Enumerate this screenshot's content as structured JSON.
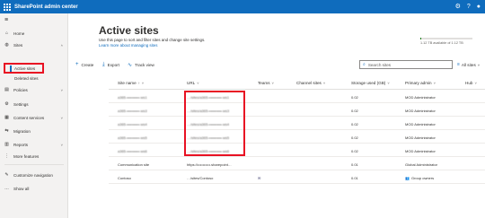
{
  "header": {
    "app_title": "SharePoint admin center",
    "icons": [
      "waffle-icon",
      "gear-icon",
      "help-icon",
      "avatar-icon"
    ]
  },
  "sidebar": {
    "items": [
      {
        "label": "Home",
        "icon": "home-icon"
      },
      {
        "label": "Sites",
        "icon": "globe-icon",
        "expanded": true
      },
      {
        "label": "Active sites",
        "sub": true,
        "active": true
      },
      {
        "label": "Deleted sites",
        "sub": true
      },
      {
        "label": "Policies",
        "icon": "policy-icon",
        "chevron": true
      },
      {
        "label": "Settings",
        "icon": "gear-icon"
      },
      {
        "label": "Content services",
        "icon": "content-icon",
        "chevron": true
      },
      {
        "label": "Migration",
        "icon": "migration-icon"
      },
      {
        "label": "Reports",
        "icon": "reports-icon",
        "chevron": true
      },
      {
        "label": "More features",
        "icon": "more-features-icon"
      },
      {
        "label": "Customize navigation",
        "icon": "pencil-icon"
      },
      {
        "label": "Show all",
        "icon": "ellipsis-icon"
      }
    ]
  },
  "page": {
    "title": "Active sites",
    "description": "Use this page to sort and filter sites and change site settings.",
    "learn_more": "Learn more about managing sites"
  },
  "storage": {
    "text": "1.12 TB available of 1.12 TB",
    "used_fraction": 0.02
  },
  "toolbar": {
    "create": "Create",
    "export": "Export",
    "track_view": "Track view",
    "search_placeholder": "Search sites",
    "filter": "All sites"
  },
  "table": {
    "columns": [
      "Site name",
      "URL",
      "Teams",
      "Channel sites",
      "Storage used (GB)",
      "Primary admin",
      "Hub"
    ],
    "sort_indicator": "↑",
    "rows": [
      {
        "name": "a365-••••••••••-ws1",
        "url": "…/sites/a365-••••••••••-ws1",
        "teams": "",
        "channel": "",
        "storage": "0.02",
        "admin": "MOD Administrator",
        "hub": "",
        "blurred": true
      },
      {
        "name": "a365-••••••••••-ws3",
        "url": "…/sites/a365-••••••••••-ws3",
        "teams": "",
        "channel": "",
        "storage": "0.02",
        "admin": "MOD Administrator",
        "hub": "",
        "blurred": true
      },
      {
        "name": "a365-••••••••••-ws4",
        "url": "…/sites/a365-••••••••••-ws4",
        "teams": "",
        "channel": "",
        "storage": "0.02",
        "admin": "MOD Administrator",
        "hub": "",
        "blurred": true
      },
      {
        "name": "a365-••••••••••-ws5",
        "url": "…/sites/a365-••••••••••-ws5",
        "teams": "",
        "channel": "",
        "storage": "0.02",
        "admin": "MOD Administrator",
        "hub": "",
        "blurred": true
      },
      {
        "name": "a365-••••••••••-ws6",
        "url": "…/sites/a365-••••••••••-ws6",
        "teams": "",
        "channel": "",
        "storage": "0.02",
        "admin": "MOD Administrator",
        "hub": "",
        "blurred": true
      },
      {
        "name": "Communication site",
        "url": "https://••••••••••.sharepoint…",
        "teams": "",
        "channel": "",
        "storage": "0.01",
        "admin": "Global Administrator",
        "hub": ""
      },
      {
        "name": "Contoso",
        "url": "…/sites/Contoso",
        "teams": "✉",
        "channel": "",
        "storage": "0.01",
        "admin": "Group owners",
        "hub": ""
      }
    ]
  },
  "colors": {
    "brand": "#0f6cbd",
    "highlight": "#e81123"
  }
}
